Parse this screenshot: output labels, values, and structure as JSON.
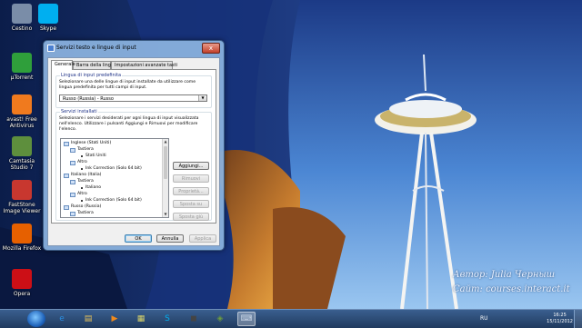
{
  "desktop_icons": [
    {
      "label": "Cestino",
      "icon": "recycle-bin-icon",
      "color": "#7a8da8"
    },
    {
      "label": "Skype",
      "icon": "skype-icon",
      "color": "#00aff0"
    },
    {
      "label": "µTorrent",
      "icon": "utorrent-icon",
      "color": "#2f9f3b"
    },
    {
      "label": "avast! Free Antivirus",
      "icon": "avast-icon",
      "color": "#f07a1e"
    },
    {
      "label": "Camtasia Studio 7",
      "icon": "camtasia-icon",
      "color": "#5e8f3d"
    },
    {
      "label": "FastStone Image Viewer",
      "icon": "faststone-icon",
      "color": "#c8372f"
    },
    {
      "label": "Mozilla Firefox",
      "icon": "firefox-icon",
      "color": "#e66000"
    },
    {
      "label": "Opera",
      "icon": "opera-icon",
      "color": "#cc0f16"
    }
  ],
  "dialog": {
    "title": "Servizi testo e lingue di input",
    "close_label": "x",
    "tabs": [
      "Generale",
      "Barra della lingua",
      "Impostazioni avanzate tasti"
    ],
    "default_lang_group": "Lingua di input predefinita",
    "default_lang_desc": "Selezionare una delle lingue di input installate da utilizzare come lingua predefinita per tutti campi di input.",
    "default_lang_value": "Russo (Russia) - Russo",
    "installed_group": "Servizi installati",
    "installed_desc": "Selezionare i servizi desiderati per ogni lingua di input visualizzata nell'elenco. Utilizzare i pulsanti Aggiungi e Rimuovi per modificare l'elenco.",
    "tree": [
      {
        "text": "Inglese (Stati Uniti)",
        "kind": "lang"
      },
      {
        "text": "Tastiera",
        "kind": "group"
      },
      {
        "text": "Stati Uniti",
        "kind": "item"
      },
      {
        "text": "Altro",
        "kind": "group"
      },
      {
        "text": "Ink Correction (Solo 64 bit)",
        "kind": "item"
      },
      {
        "text": "Italiano (Italia)",
        "kind": "lang"
      },
      {
        "text": "Tastiera",
        "kind": "group"
      },
      {
        "text": "Italiano",
        "kind": "item"
      },
      {
        "text": "Altro",
        "kind": "group"
      },
      {
        "text": "Ink Correction (Solo 64 bit)",
        "kind": "item"
      },
      {
        "text": "Russo (Russia)",
        "kind": "lang"
      },
      {
        "text": "Tastiera",
        "kind": "group"
      }
    ],
    "buttons": {
      "add": "Aggiungi...",
      "remove": "Rimuovi",
      "properties": "Proprietà...",
      "move_up": "Sposta su",
      "move_down": "Sposta giù"
    },
    "footer": {
      "ok": "OK",
      "cancel": "Annulla",
      "apply": "Applica"
    }
  },
  "watermark": {
    "author": "Автор: Julia Черныш",
    "site": "Сайт: courses.interact.it"
  },
  "taskbar": {
    "apps": [
      {
        "name": "ie-icon",
        "glyph": "e",
        "color": "#2b8de0"
      },
      {
        "name": "explorer-icon",
        "glyph": "▤",
        "color": "#e7c25a"
      },
      {
        "name": "media-player-icon",
        "glyph": "▶",
        "color": "#f08a1c"
      },
      {
        "name": "notes-icon",
        "glyph": "▦",
        "color": "#d8d36a"
      },
      {
        "name": "skype-icon",
        "glyph": "S",
        "color": "#00aff0"
      },
      {
        "name": "media-icon",
        "glyph": "◼",
        "color": "#444444"
      },
      {
        "name": "camtasia-icon",
        "glyph": "◈",
        "color": "#6c9b3f"
      },
      {
        "name": "keyboard-icon",
        "glyph": "⌨",
        "color": "#c9d6e6"
      }
    ],
    "language": "RU",
    "time": "16:25",
    "date": "15/11/2012"
  }
}
